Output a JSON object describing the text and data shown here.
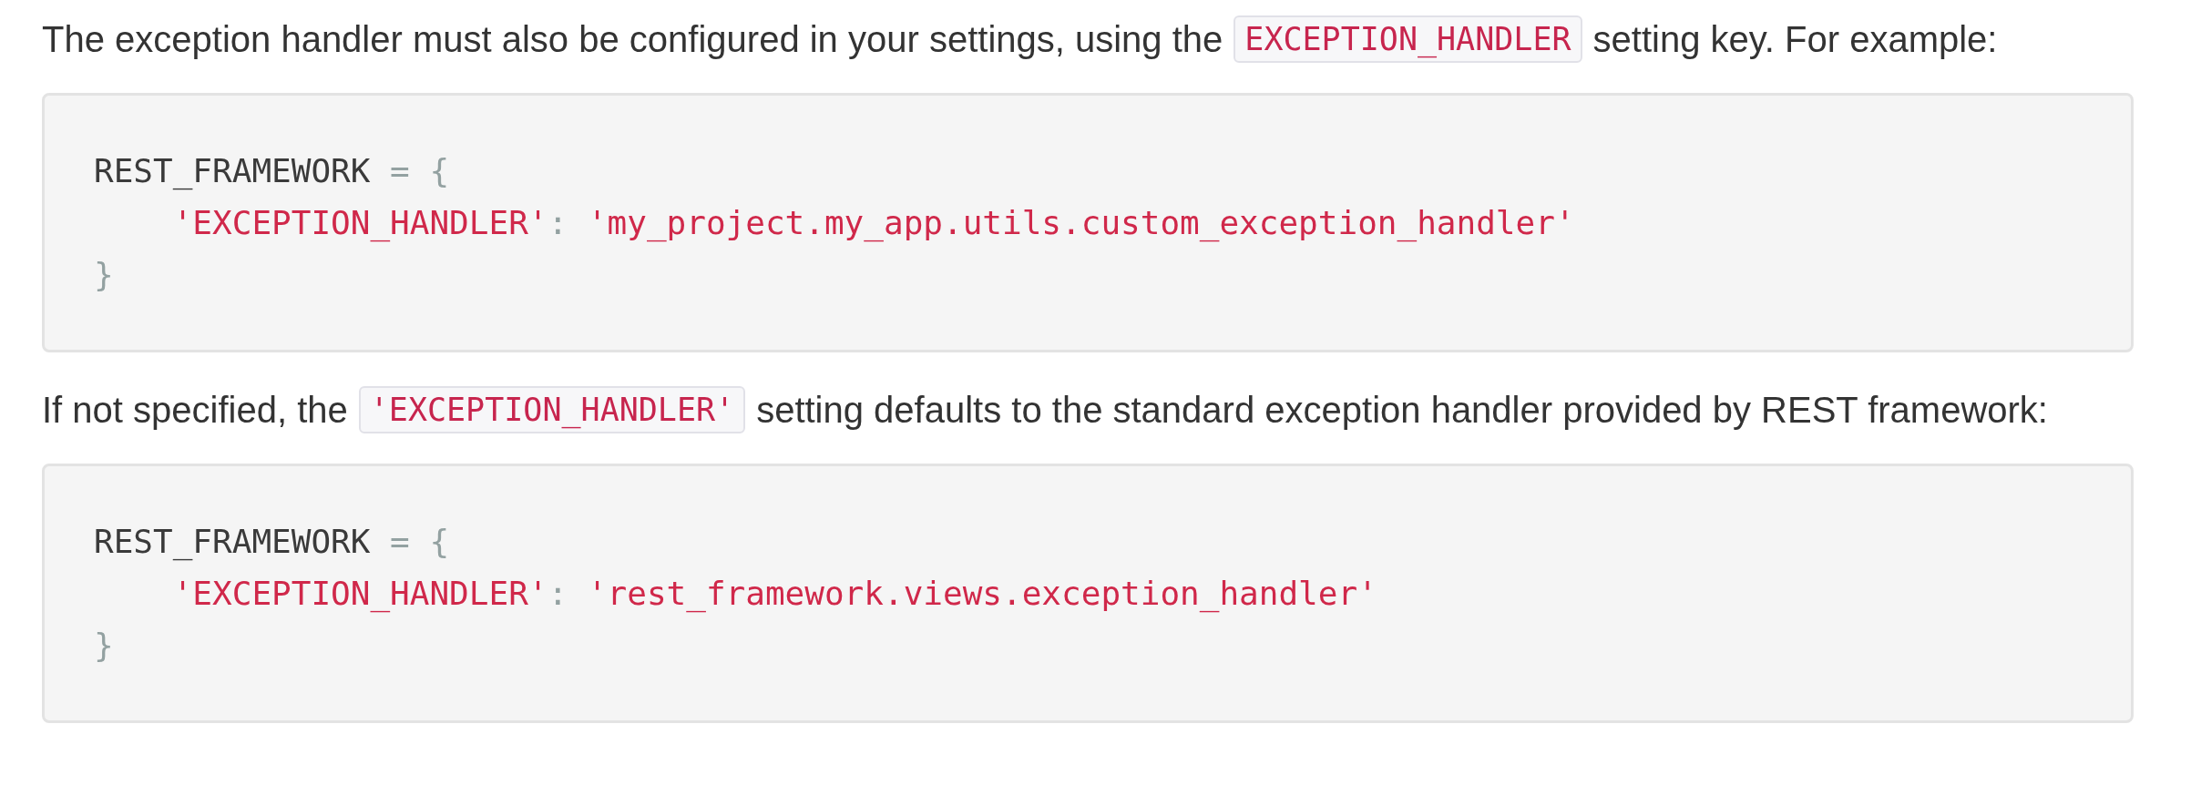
{
  "blocks": [
    {
      "kind": "paragraph",
      "parts": [
        {
          "kind": "text",
          "text": "The exception handler must also be configured in your settings, using the"
        },
        {
          "kind": "code",
          "text": "EXCEPTION_HANDLER"
        },
        {
          "kind": "text",
          "text": "setting key. For example:"
        }
      ]
    },
    {
      "kind": "code",
      "lines": [
        {
          "indented": false,
          "tokens": [
            {
              "kind": "plain",
              "text": "REST_FRAMEWORK "
            },
            {
              "kind": "punct",
              "text": "= {"
            }
          ]
        },
        {
          "indented": true,
          "tokens": [
            {
              "kind": "string",
              "text": "'EXCEPTION_HANDLER'"
            },
            {
              "kind": "punct",
              "text": ": "
            },
            {
              "kind": "string",
              "text": "'my_project.my_app.utils.custom_exception_handler'"
            }
          ]
        },
        {
          "indented": false,
          "tokens": [
            {
              "kind": "punct",
              "text": "}"
            }
          ]
        }
      ]
    },
    {
      "kind": "paragraph",
      "parts": [
        {
          "kind": "text",
          "text": "If not specified, the"
        },
        {
          "kind": "code",
          "text": "'EXCEPTION_HANDLER'"
        },
        {
          "kind": "text",
          "text": "setting defaults to the standard exception handler provided by REST framework:"
        }
      ]
    },
    {
      "kind": "code",
      "lines": [
        {
          "indented": false,
          "tokens": [
            {
              "kind": "plain",
              "text": "REST_FRAMEWORK "
            },
            {
              "kind": "punct",
              "text": "= {"
            }
          ]
        },
        {
          "indented": true,
          "tokens": [
            {
              "kind": "string",
              "text": "'EXCEPTION_HANDLER'"
            },
            {
              "kind": "punct",
              "text": ": "
            },
            {
              "kind": "string",
              "text": "'rest_framework.views.exception_handler'"
            }
          ]
        },
        {
          "indented": false,
          "tokens": [
            {
              "kind": "punct",
              "text": "}"
            }
          ]
        }
      ]
    }
  ]
}
